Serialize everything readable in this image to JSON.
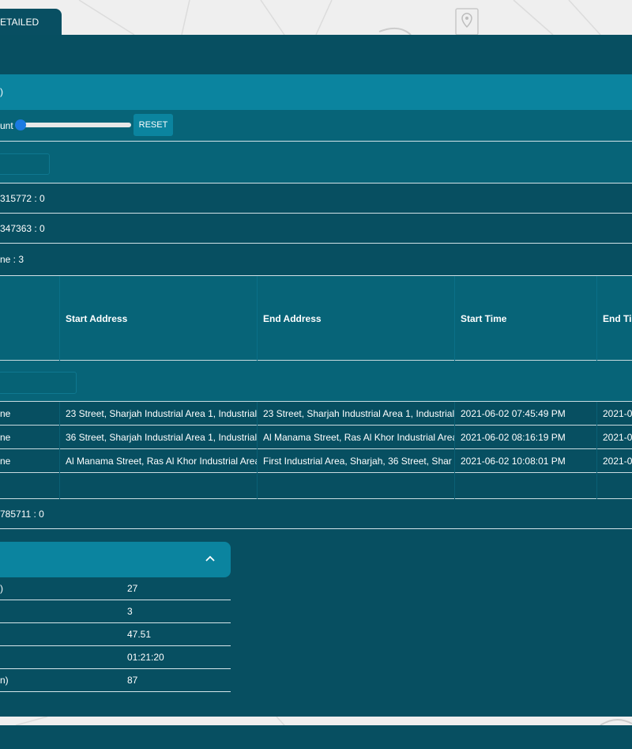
{
  "tab": {
    "label": "ETAILED"
  },
  "title": {
    "text": ")"
  },
  "slider": {
    "label": "unt",
    "reset_label": "RESET",
    "value_fraction": 0.0
  },
  "info_rows": [
    {
      "text": "315772 : 0"
    },
    {
      "text": "347363 : 0"
    },
    {
      "text": "ne : 3"
    }
  ],
  "table": {
    "headers": [
      "",
      "Start Address",
      "End Address",
      "Start Time",
      "End Ti"
    ],
    "rows": [
      [
        "ne",
        "23 Street, Sharjah Industrial Area 1, Industrial",
        "23 Street, Sharjah Industrial Area 1, Industrial",
        "2021-06-02 07:45:49 PM",
        "2021-0"
      ],
      [
        "ne",
        "36 Street, Sharjah Industrial Area 1, Industrial",
        "Al Manama Street, Ras Al Khor Industrial Area",
        "2021-06-02 08:16:19 PM",
        "2021-0"
      ],
      [
        "ne",
        "Al Manama Street, Ras Al Khor Industrial Area",
        "First Industrial Area, Sharjah, 36 Street, Shar",
        "2021-06-02 10:08:01 PM",
        "2021-0"
      ]
    ]
  },
  "footer_info": {
    "text": "785711 : 0"
  },
  "summary": {
    "items": [
      {
        "label": ")",
        "value": "27"
      },
      {
        "label": "",
        "value": "3"
      },
      {
        "label": "",
        "value": "47.51"
      },
      {
        "label": "",
        "value": "01:21:20"
      },
      {
        "label": "n)",
        "value": "87"
      }
    ]
  },
  "colors": {
    "panel": "#074f61",
    "header": "#0b849f",
    "band": "#076478",
    "slider_thumb": "#1b7ae2"
  }
}
